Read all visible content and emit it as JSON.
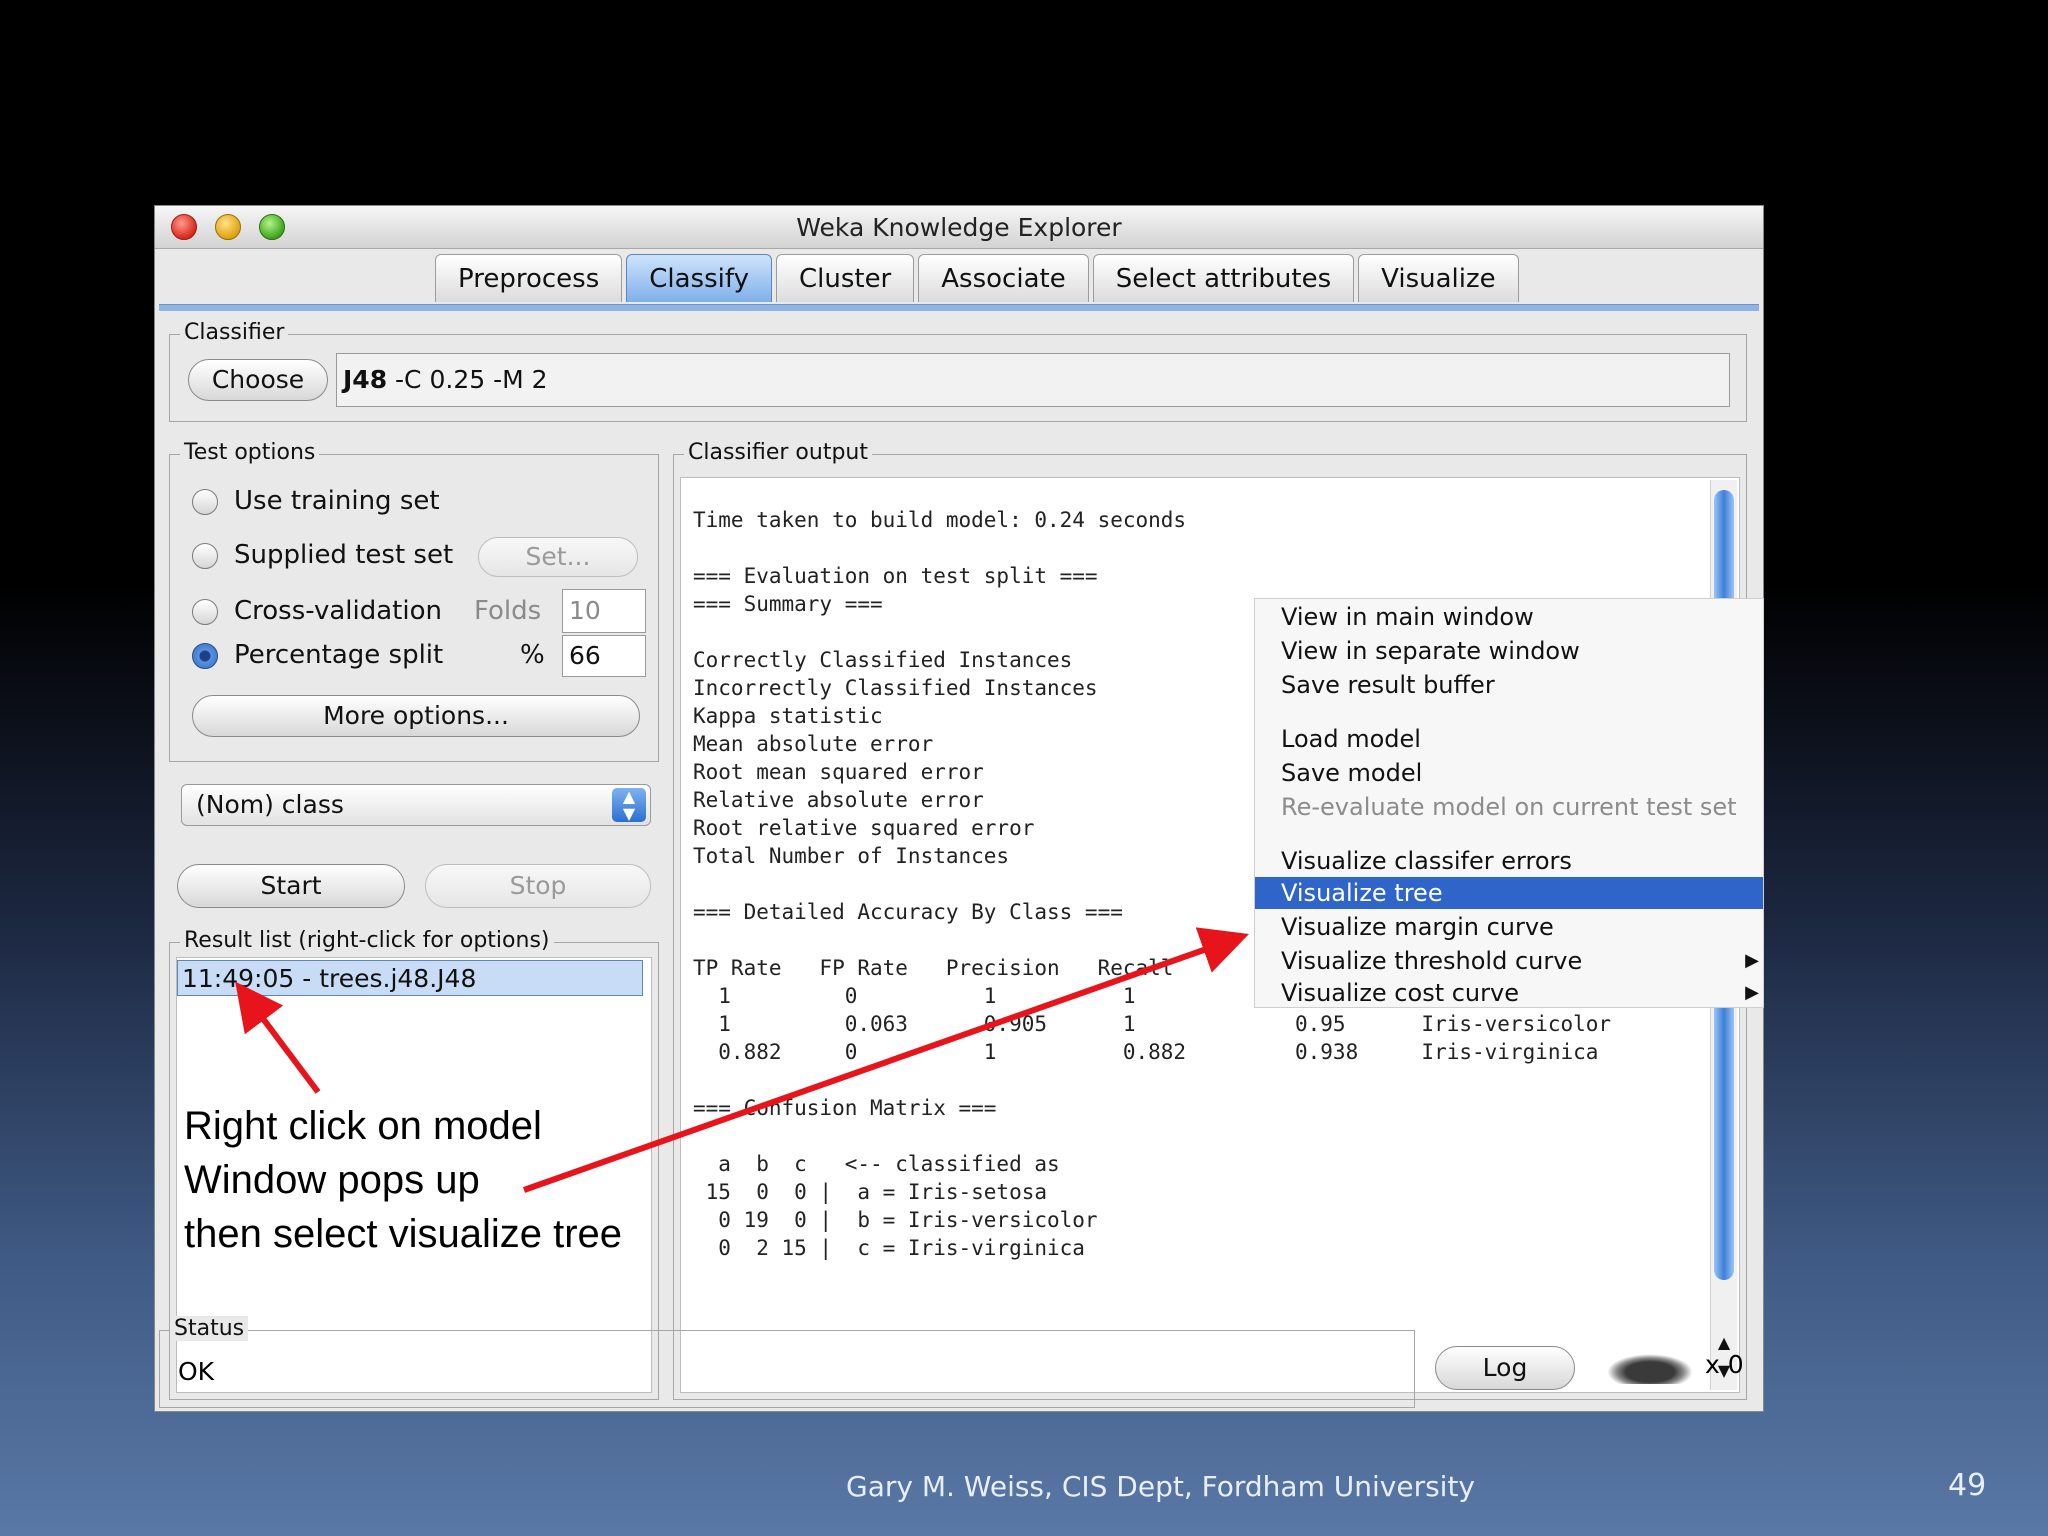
{
  "window": {
    "title": "Weka Knowledge Explorer"
  },
  "tabs": [
    "Preprocess",
    "Classify",
    "Cluster",
    "Associate",
    "Select attributes",
    "Visualize"
  ],
  "classifier": {
    "label": "Classifier",
    "choose": "Choose",
    "value_bold": "J48",
    "value_rest": " -C 0.25 -M 2"
  },
  "test_options": {
    "label": "Test options",
    "use_training": "Use training set",
    "supplied": "Supplied test set",
    "set_button": "Set...",
    "cross_validation": "Cross-validation",
    "folds_label": "Folds",
    "folds_value": "10",
    "percentage_split": "Percentage split",
    "percent_label": "%",
    "percent_value": "66",
    "more_options": "More options..."
  },
  "class_select": "(Nom) class",
  "controls": {
    "start": "Start",
    "stop": "Stop"
  },
  "result_list": {
    "label": "Result list (right-click for options)",
    "item": "11:49:05 - trees.j48.J48"
  },
  "output": {
    "label": "Classifier output",
    "time": "Time taken to build model: 0.24 seconds",
    "eval_header": "=== Evaluation on test split ===",
    "summary_header": "=== Summary ===",
    "stats": [
      "Correctly Classified Instances",
      "Incorrectly Classified Instances",
      "Kappa statistic",
      "Mean absolute error",
      "Root mean squared error",
      "Relative absolute error",
      "Root relative squared error",
      "Total Number of Instances"
    ],
    "detail_header": "=== Detailed Accuracy By Class ===",
    "acc_header": "TP Rate   FP Rate   Precision   Recall",
    "acc_rows": [
      "  1         0          1          1",
      "  1         0.063      0.905      1",
      "  0.882     0          1          0.882"
    ],
    "acc_right": [
      "0.95      Iris-versicolor",
      "0.938     Iris-virginica"
    ],
    "confusion_header": "=== Confusion Matrix ===",
    "confusion": [
      "  a  b  c   <-- classified as",
      " 15  0  0 |  a = Iris-setosa",
      "  0 19  0 |  b = Iris-versicolor",
      "  0  2 15 |  c = Iris-virginica"
    ]
  },
  "context_menu": [
    "View in main window",
    "View in separate window",
    "Save result buffer",
    "Load model",
    "Save model",
    "Re-evaluate model on current test set",
    "Visualize classifer errors",
    "Visualize tree",
    "Visualize margin curve",
    "Visualize threshold curve",
    "Visualize cost curve"
  ],
  "status": {
    "label": "Status",
    "value": "OK",
    "log": "Log",
    "count": "x 0"
  },
  "annotation": [
    "Right click on model",
    "Window pops up",
    "then select visualize tree"
  ],
  "footer": {
    "credit": "Gary M. Weiss, CIS Dept, Fordham University",
    "page": "49"
  },
  "colors": {
    "selection": "#2f64c8",
    "arrow": "#e8141c",
    "active_tab": "#7fb0ea"
  }
}
